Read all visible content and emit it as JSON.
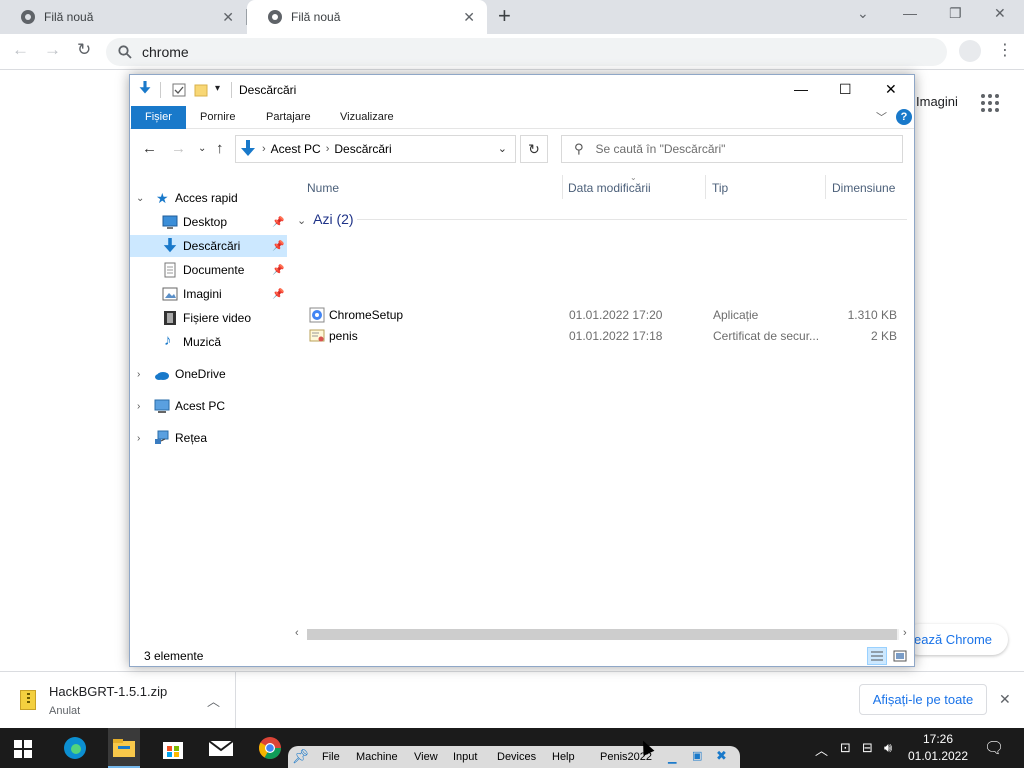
{
  "chrome": {
    "tabs": [
      {
        "title": "Filă nouă",
        "active": false
      },
      {
        "title": "Filă nouă",
        "active": true
      }
    ],
    "omnibox": {
      "text": "chrome"
    },
    "page": {
      "top_link": "Imagini",
      "customize_label": "ează Chrome"
    },
    "download_bar": {
      "file_name": "HackBGRT-1.5.1.zip",
      "status": "Anulat",
      "show_all_label": "Afișați-le pe toate"
    }
  },
  "explorer": {
    "title": "Descărcări",
    "ribbon_tabs": [
      "Fișier",
      "Pornire",
      "Partajare",
      "Vizualizare"
    ],
    "address": {
      "crumbs": [
        "Acest PC",
        "Descărcări"
      ]
    },
    "search_placeholder": "Se caută în \"Descărcări\"",
    "nav": {
      "quick_access": "Acces rapid",
      "items": [
        {
          "label": "Desktop",
          "pinned": true
        },
        {
          "label": "Descărcări",
          "pinned": true,
          "selected": true
        },
        {
          "label": "Documente",
          "pinned": true
        },
        {
          "label": "Imagini",
          "pinned": true
        },
        {
          "label": "Fișiere video",
          "pinned": false
        },
        {
          "label": "Muzică",
          "pinned": false
        }
      ],
      "onedrive": "OneDrive",
      "this_pc": "Acest PC",
      "network": "Rețea"
    },
    "columns": [
      "Nume",
      "Data modificării",
      "Tip",
      "Dimensiune"
    ],
    "group": "Azi (2)",
    "files": [
      {
        "name": "ChromeSetup",
        "date": "01.01.2022 17:20",
        "type": "Aplicație",
        "size": "1.310 KB"
      },
      {
        "name": "penis",
        "date": "01.01.2022 17:18",
        "type": "Certificat de secur...",
        "size": "2 KB"
      }
    ],
    "status": "3 elemente"
  },
  "vbox": {
    "menus": [
      "File",
      "Machine",
      "View",
      "Input",
      "Devices",
      "Help"
    ],
    "vm_name": "Penis2022"
  },
  "tray": {
    "time": "17:26",
    "date": "01.01.2022"
  },
  "colors": {
    "accent": "#1979ca",
    "selection": "#cce8ff",
    "taskbar": "#1b1b1b"
  }
}
